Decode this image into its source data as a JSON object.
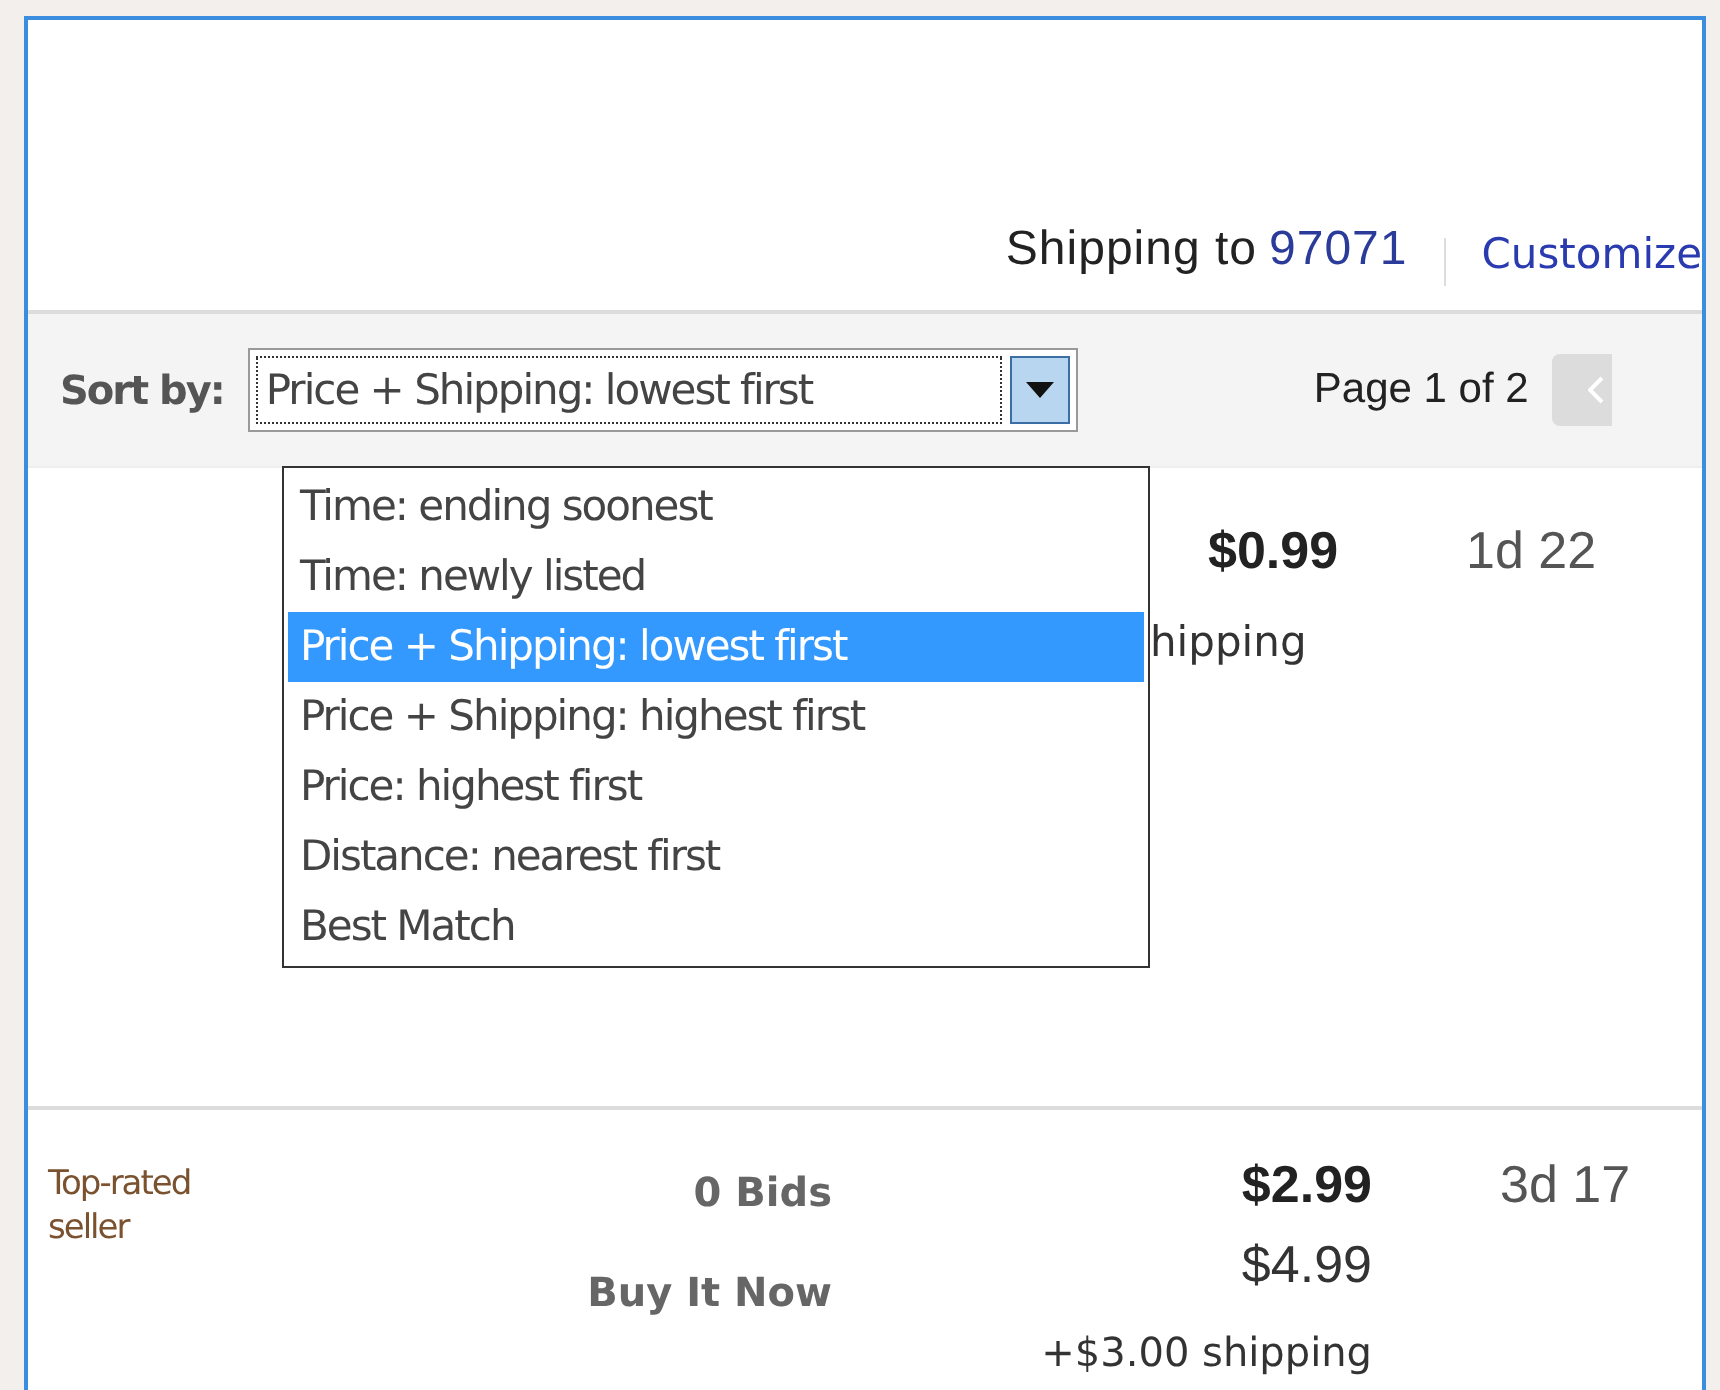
{
  "header": {
    "shipping_label": "Shipping to",
    "zip": "97071",
    "customize": "Customize"
  },
  "sort_bar": {
    "label": "Sort by:",
    "value": "Price + Shipping: lowest first",
    "page": "Page 1 of 2",
    "expanded": true,
    "options": [
      {
        "label": "Time: ending soonest",
        "selected": false
      },
      {
        "label": "Time: newly listed",
        "selected": false
      },
      {
        "label": "Price + Shipping: lowest first",
        "selected": true
      },
      {
        "label": "Price + Shipping: highest first",
        "selected": false
      },
      {
        "label": "Price: highest first",
        "selected": false
      },
      {
        "label": "Distance: nearest first",
        "selected": false
      },
      {
        "label": "Best Match",
        "selected": false
      }
    ]
  },
  "rows": [
    {
      "price": "$0.99",
      "shipping": "hipping",
      "time": "1d 22"
    },
    {
      "seller": "Top-rated seller",
      "bids": "0 Bids",
      "buy_it_now": "Buy It Now",
      "price": "$2.99",
      "bin_price": "$4.99",
      "shipping": "+$3.00 shipping",
      "time": "3d 17"
    }
  ]
}
